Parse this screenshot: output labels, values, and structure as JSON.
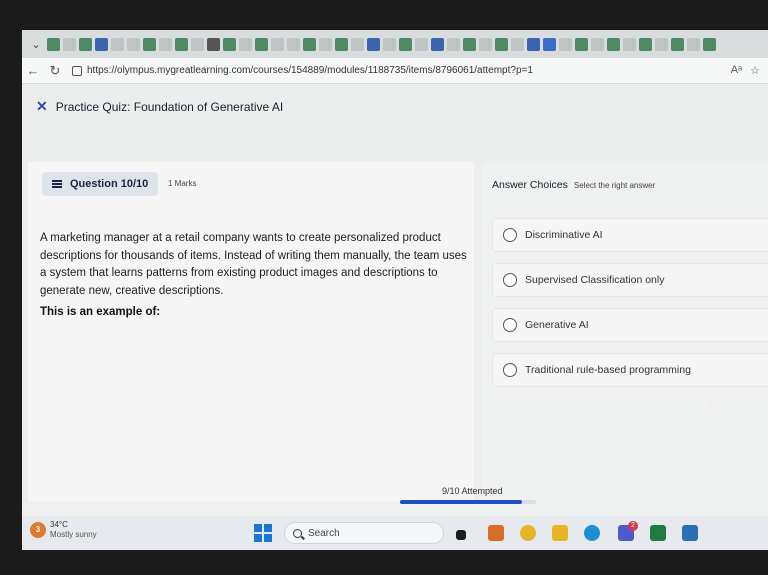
{
  "browser": {
    "url": "https://olympus.mygreatlearning.com/courses/154889/modules/1188735/items/8796061/attempt?p=1",
    "reader_label": "Aᵃ"
  },
  "quiz": {
    "title": "Practice Quiz: Foundation of Generative AI",
    "question_badge": "Question 10/10",
    "marks": "1 Marks",
    "question_text": "A marketing manager at a retail company wants to create personalized product descriptions for thousands of items. Instead of writing them manually, the team uses a system that learns patterns from existing product images and descriptions to generate new, creative descriptions.",
    "prompt": "This is an example of:",
    "answer_heading": "Answer Choices",
    "answer_subheading": "Select the right answer",
    "choices": [
      "Discriminative AI",
      "Supervised Classification only",
      "Generative AI",
      "Traditional rule-based programming"
    ],
    "progress_label": "9/10 Attempted",
    "progress_fraction": 0.9
  },
  "taskbar": {
    "weather_badge": "3",
    "temperature": "34°C",
    "condition": "Mostly sunny",
    "search_placeholder": "Search",
    "teams_badge": "2"
  },
  "colors": {
    "accent": "#1f4fc0",
    "brand_close": "#2a4bb0"
  }
}
